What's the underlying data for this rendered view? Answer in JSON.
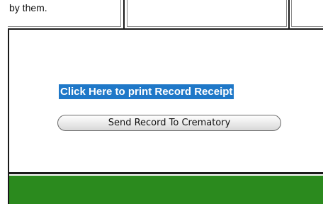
{
  "top_row": {
    "cell_1_text": "by them.",
    "cell_2_text": "",
    "cell_3_text": ""
  },
  "actions": {
    "print_link_label": "Click Here to print Record Receipt",
    "send_button_label": "Send Record To Crematory"
  },
  "colors": {
    "link_highlight": "#1f78c8",
    "footer_bar": "#2b8a1e"
  }
}
